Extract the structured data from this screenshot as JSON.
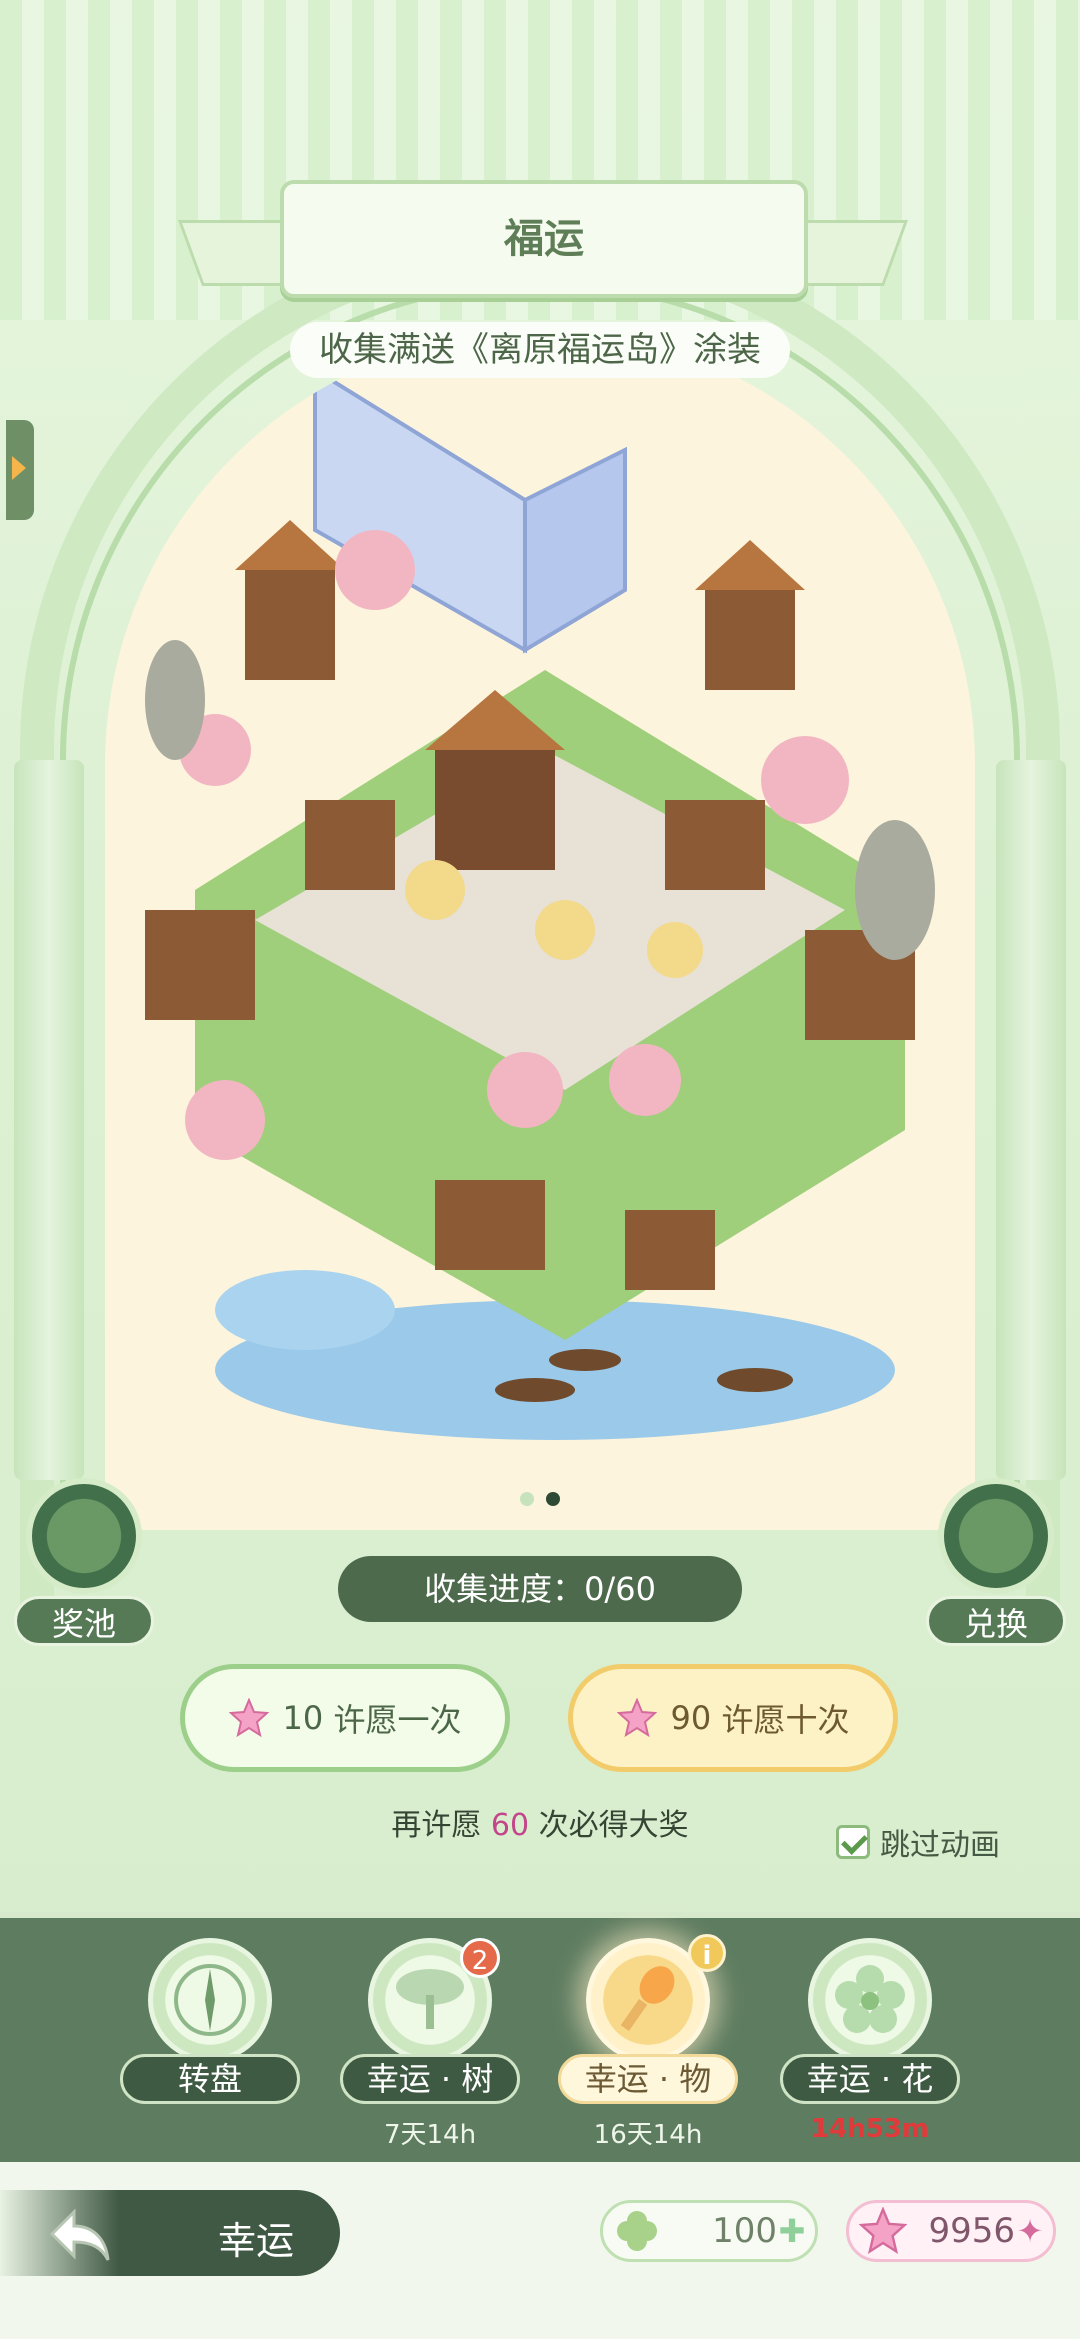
{
  "header": {
    "title": "福运",
    "subtitle": "收集满送《离原福运岛》涂装"
  },
  "carousel": {
    "pages": 2,
    "active_page": 2
  },
  "corner_buttons": {
    "left_label": "奖池",
    "right_label": "兑换"
  },
  "progress": {
    "label": "收集进度：0/60"
  },
  "wish_buttons": {
    "single": {
      "count": "10",
      "label": "许愿一次"
    },
    "ten": {
      "count": "90",
      "label": "许愿十次"
    }
  },
  "guarantee": {
    "prefix": "再许愿 ",
    "number": "60",
    "suffix": " 次必得大奖"
  },
  "skip_animation": {
    "label": "跳过动画",
    "checked": true
  },
  "tabs": [
    {
      "name": "转盘",
      "timer": "",
      "icon": "compass-icon"
    },
    {
      "name": "幸运 · 树",
      "timer": "7天14h",
      "badge": "2",
      "icon": "tree-icon"
    },
    {
      "name": "幸运 · 物",
      "timer": "16天14h",
      "icon": "brush-icon",
      "active": true
    },
    {
      "name": "幸运 · 花",
      "timer": "14h53m",
      "icon": "flower-icon",
      "timer_color": "#e03a3a"
    }
  ],
  "bottom": {
    "back_label": "幸运",
    "clover_currency": "100",
    "star_currency": "9956"
  },
  "colors": {
    "accent_green": "#5e7c60",
    "wish_gold": "#f2cc6a",
    "highlight_pink": "#c4468a"
  }
}
